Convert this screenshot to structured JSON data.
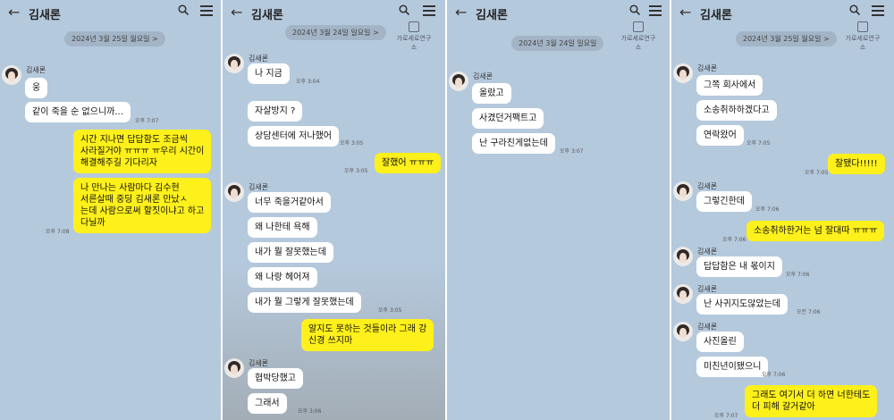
{
  "panels": [
    {
      "contact_name": "김새론",
      "date": "2024년 3월 25일 월요일 >",
      "watermark": "",
      "sender_names": [
        "김새론"
      ],
      "messages": [
        {
          "text": "웅",
          "time": ""
        },
        {
          "text": "같이 죽을 순 없으니까...",
          "time": "오후 7:07"
        },
        {
          "text": "시간 지나면 답답함도 조금씩\n사라질거야 ㅠㅠㅠ ㅠ우리 시간이\n해결해주길 기다리자",
          "time": ""
        },
        {
          "text": "나 만나는 사람마다 김수현\n서른살때 중딩 김새론 만났ㅅ\n는데 사람으로써 할짓이냐고 하고\n다닐까",
          "time": "오후 7:08"
        }
      ]
    },
    {
      "contact_name": "김새론",
      "date": "2024년 3월 24일 일요일 >",
      "watermark": "가로세로연구소",
      "sender_names": [
        "김새론",
        "김새론",
        "김새론"
      ],
      "messages": [
        {
          "text": "나 지금",
          "time": "오후 3:04"
        },
        {
          "text": "자살방지 ?",
          "time": ""
        },
        {
          "text": "상담센터에 저나했어",
          "time": "오후 3:05"
        },
        {
          "text": "잘했어 ㅠㅠㅠ",
          "time": "오후 3:05"
        },
        {
          "text": "너무 죽을거같아서",
          "time": ""
        },
        {
          "text": "왜 나한테 욕해",
          "time": ""
        },
        {
          "text": "내가 뭘 잘못했는데",
          "time": ""
        },
        {
          "text": "왜 나랑 헤어져",
          "time": ""
        },
        {
          "text": "내가 뭘 그렇게 잘못했는데",
          "time": "오후 3:05"
        },
        {
          "text": "알지도 못하는 것들이라 그래 강\n신경 쓰지마",
          "time": ""
        },
        {
          "text": "협박당했고",
          "time": ""
        },
        {
          "text": "그래서",
          "time": "오후 3:06"
        }
      ]
    },
    {
      "contact_name": "김새론",
      "date": "2024년 3월 24일 일요일",
      "watermark": "가로세로연구소",
      "sender_names": [
        "김새론"
      ],
      "messages": [
        {
          "text": "올랐고",
          "time": ""
        },
        {
          "text": "사겼던거팩트고",
          "time": ""
        },
        {
          "text": "난 구라친게없는데",
          "time": "오후 3:07"
        }
      ]
    },
    {
      "contact_name": "김새론",
      "date": "2024년 3월 25일 월요일 >",
      "watermark": "가로세로연구소",
      "sender_names": [
        "김새론",
        "김새론",
        "김새론",
        "김새론",
        "김새론"
      ],
      "messages": [
        {
          "text": "그쪽 회사에서",
          "time": ""
        },
        {
          "text": "소송취하하겠다고",
          "time": ""
        },
        {
          "text": "연락왔어",
          "time": "오후 7:05"
        },
        {
          "text": "잘됐다!!!!!",
          "time": "오후 7:05"
        },
        {
          "text": "그렇긴한데",
          "time": "오후 7:06"
        },
        {
          "text": "소송취하한거는 넘 잘대따 ㅠㅠㅠ",
          "time": "오후 7:06"
        },
        {
          "text": "답답함은 내 몫이지",
          "time": "오후 7:06"
        },
        {
          "text": "난 사귀지도않았는데",
          "time": "오전 7:06"
        },
        {
          "text": "사진올린",
          "time": ""
        },
        {
          "text": "미친년이됐으니",
          "time": "오후 7:06"
        },
        {
          "text": "그래도 여기서 더 하면 너한테도\n더 피해 갈거같아",
          "time": "오후 7:07"
        }
      ]
    }
  ]
}
